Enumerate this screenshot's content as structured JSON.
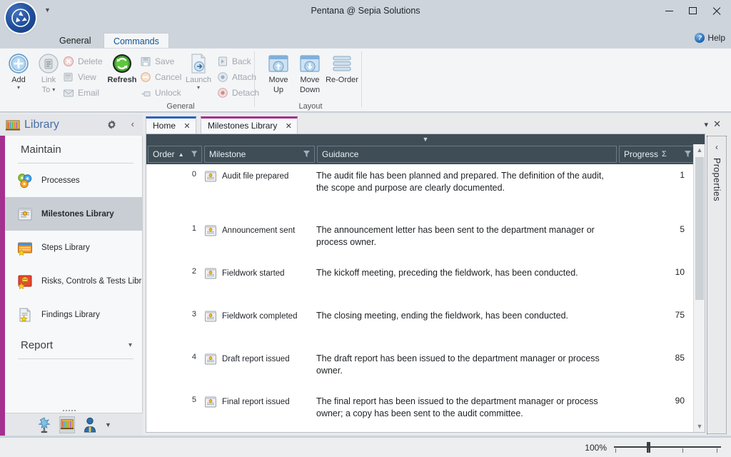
{
  "window": {
    "title": "Pentana @ Sepia Solutions",
    "minimize": "minimize-icon",
    "maximize": "maximize-icon",
    "close": "close-icon"
  },
  "ribbon": {
    "tabs": [
      {
        "label": "General",
        "active": false
      },
      {
        "label": "Commands",
        "active": true
      }
    ],
    "help": {
      "label": "Help",
      "icon": "help-icon"
    },
    "groups": [
      {
        "name": "General",
        "label": "General",
        "big_buttons": [
          {
            "label_line1": "Add",
            "label_line2": "",
            "caret": true,
            "enabled": true,
            "icon": "add-icon"
          },
          {
            "label_line1": "Link",
            "label_line2": "To",
            "caret": true,
            "enabled": false,
            "icon": "link-to-icon"
          },
          {
            "label_line1": "Refresh",
            "label_line2": "",
            "caret": false,
            "enabled": true,
            "icon": "refresh-icon"
          },
          {
            "label_line1": "Launch",
            "label_line2": "",
            "caret": true,
            "enabled": false,
            "icon": "launch-icon"
          }
        ],
        "small_buttons": [
          {
            "label": "Delete",
            "enabled": false,
            "icon": "delete-icon"
          },
          {
            "label": "View",
            "enabled": false,
            "icon": "view-icon"
          },
          {
            "label": "Email",
            "enabled": false,
            "icon": "email-icon"
          },
          {
            "label": "Save",
            "enabled": false,
            "icon": "save-icon"
          },
          {
            "label": "Cancel",
            "enabled": false,
            "icon": "cancel-icon"
          },
          {
            "label": "Unlock",
            "enabled": false,
            "icon": "unlock-icon"
          },
          {
            "label": "Back",
            "enabled": false,
            "icon": "back-icon"
          },
          {
            "label": "Attach",
            "enabled": false,
            "icon": "attach-icon"
          },
          {
            "label": "Detach",
            "enabled": false,
            "icon": "detach-icon"
          }
        ]
      },
      {
        "name": "Layout",
        "label": "Layout",
        "big_buttons": [
          {
            "label_line1": "Move",
            "label_line2": "Up",
            "caret": false,
            "enabled": true,
            "icon": "move-up-icon"
          },
          {
            "label_line1": "Move",
            "label_line2": "Down",
            "caret": false,
            "enabled": true,
            "icon": "move-down-icon"
          },
          {
            "label_line1": "Re-Order",
            "label_line2": "",
            "caret": false,
            "enabled": true,
            "icon": "re-order-icon"
          }
        ]
      }
    ]
  },
  "sidebar": {
    "title": "Library",
    "title_icon": "library-icon",
    "gear_icon": "gear-icon",
    "collapse_icon": "chevron-left-icon",
    "sections": [
      {
        "label": "Maintain",
        "collapsible": false,
        "items": [
          {
            "label": "Processes",
            "icon": "processes-icon",
            "selected": false
          },
          {
            "label": "Milestones Library",
            "icon": "milestones-icon",
            "selected": true
          },
          {
            "label": "Steps Library",
            "icon": "steps-icon",
            "selected": false
          },
          {
            "label": "Risks, Controls & Tests Libra",
            "icon": "risks-icon",
            "selected": false
          },
          {
            "label": "Findings Library",
            "icon": "findings-icon",
            "selected": false
          }
        ]
      },
      {
        "label": "Report",
        "collapsible": true,
        "items": []
      }
    ],
    "footer_icons": [
      {
        "name": "planning-icon",
        "selected": false
      },
      {
        "name": "library-icon",
        "selected": true
      },
      {
        "name": "people-icon",
        "selected": false
      },
      {
        "name": "more-caret-icon",
        "selected": false
      }
    ]
  },
  "doc_tabs": {
    "tabs": [
      {
        "label": "Home",
        "close": "×",
        "accent": "#2a62bf",
        "active": false
      },
      {
        "label": "Milestones Library",
        "close": "×",
        "accent": "#a4308f",
        "active": true
      }
    ],
    "overflow_caret": "▾",
    "close_all": "×"
  },
  "grid": {
    "columns": [
      {
        "label": "Order",
        "sort": "asc",
        "filter": true,
        "summary": false
      },
      {
        "label": "Milestone",
        "sort": "none",
        "filter": true,
        "summary": false
      },
      {
        "label": "Guidance",
        "sort": "none",
        "filter": false,
        "summary": false
      },
      {
        "label": "Progress",
        "sort": "none",
        "filter": true,
        "summary": true
      }
    ],
    "rows": [
      {
        "order": "0",
        "milestone": "Audit file prepared",
        "guidance": "The audit file has been planned and prepared. The definition of the audit, the scope and purpose are clearly documented.",
        "progress": "1",
        "icon": "milestone-icon"
      },
      {
        "order": "1",
        "milestone": "Announcement sent",
        "guidance": "The announcement letter has been sent to the department manager or process owner.",
        "progress": "5",
        "icon": "milestone-icon"
      },
      {
        "order": "2",
        "milestone": "Fieldwork started",
        "guidance": "The kickoff meeting, preceding the fieldwork, has been conducted.",
        "progress": "10",
        "icon": "milestone-icon"
      },
      {
        "order": "3",
        "milestone": "Fieldwork completed",
        "guidance": "The closing meeting, ending the fieldwork, has been conducted.",
        "progress": "75",
        "icon": "milestone-icon"
      },
      {
        "order": "4",
        "milestone": "Draft report issued",
        "guidance": "The draft report has been issued to the department manager or process owner.",
        "progress": "85",
        "icon": "milestone-icon"
      },
      {
        "order": "5",
        "milestone": "Final report issued",
        "guidance": "The final report has been issued to the department manager or process owner; a copy has been sent to the audit committee.",
        "progress": "90",
        "icon": "milestone-icon"
      }
    ]
  },
  "properties_pane": {
    "label": "Properties",
    "expand_icon": "chevron-left-icon"
  },
  "statusbar": {
    "zoom_level": "100%"
  },
  "colors": {
    "accent_magenta": "#a4308f",
    "accent_blue": "#2a62bf",
    "grid_header": "#3e4d56",
    "titlebar": "#cdd4db",
    "ribbon": "#f4f5f7"
  }
}
